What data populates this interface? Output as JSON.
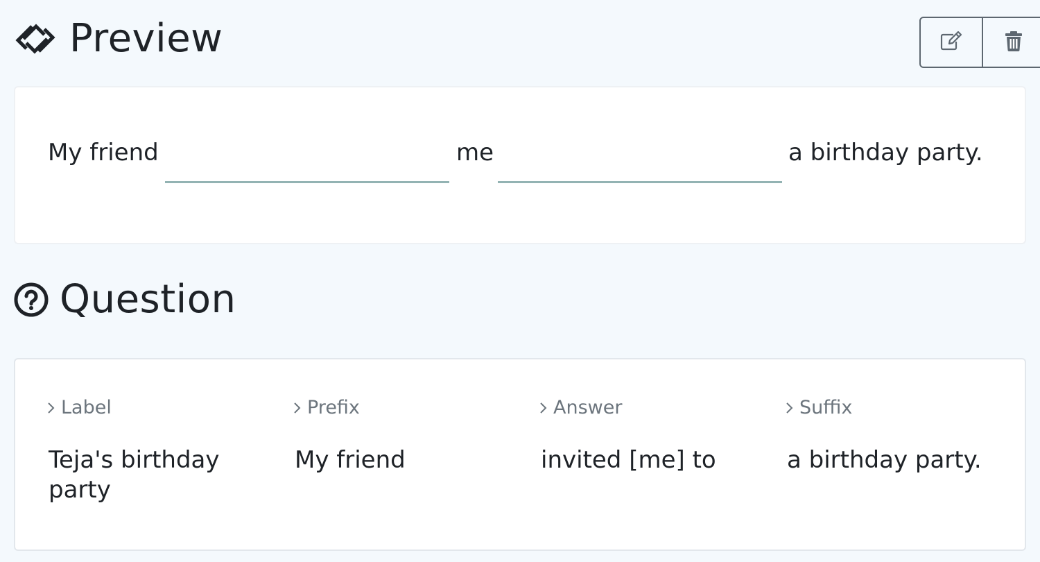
{
  "preview": {
    "title": "Preview",
    "icon": "link-chain-icon",
    "actions": {
      "edit_icon": "edit-icon",
      "delete_icon": "trash-icon"
    },
    "sentence": {
      "prefix": "My friend",
      "blank1_value": "",
      "middle": "me",
      "blank2_value": "",
      "suffix": "a birthday party."
    }
  },
  "question": {
    "title": "Question",
    "icon": "question-circle-icon",
    "fields": [
      {
        "label": "Label",
        "value": "Teja's birthday party"
      },
      {
        "label": "Prefix",
        "value": "My friend"
      },
      {
        "label": "Answer",
        "value": "invited [me] to"
      },
      {
        "label": "Suffix",
        "value": "a birthday party."
      }
    ]
  },
  "colors": {
    "background": "#f4f9fd",
    "card": "#ffffff",
    "blank_underline": "#93b3b3",
    "label_gray": "#6c757d",
    "text": "#1e2227"
  }
}
